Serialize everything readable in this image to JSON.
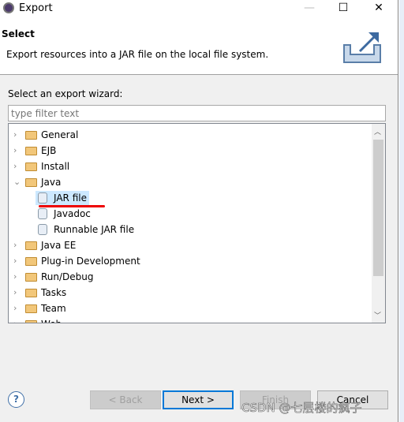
{
  "window": {
    "title": "Export",
    "minimize": "—",
    "maximize": "☐",
    "close": "✕"
  },
  "header": {
    "title": "Select",
    "description": "Export resources into a JAR file on the local file system."
  },
  "wizard_label": "Select an export wizard:",
  "filter": {
    "placeholder": "type filter text",
    "value": ""
  },
  "tree": [
    {
      "label": "General",
      "expanded": false
    },
    {
      "label": "EJB",
      "expanded": false
    },
    {
      "label": "Install",
      "expanded": false
    },
    {
      "label": "Java",
      "expanded": true
    },
    {
      "label": "JAR file",
      "child": true,
      "selected": true
    },
    {
      "label": "Javadoc",
      "child": true
    },
    {
      "label": "Runnable JAR file",
      "child": true
    },
    {
      "label": "Java EE",
      "expanded": false
    },
    {
      "label": "Plug-in Development",
      "expanded": false
    },
    {
      "label": "Run/Debug",
      "expanded": false
    },
    {
      "label": "Tasks",
      "expanded": false
    },
    {
      "label": "Team",
      "expanded": false
    },
    {
      "label": "Web",
      "expanded": false
    }
  ],
  "buttons": {
    "help": "?",
    "back": "< Back",
    "next": "Next >",
    "finish": "Finish",
    "cancel": "Cancel"
  },
  "watermark": "CSDN @七层楼的疯子",
  "colors": {
    "selection": "#cce8ff",
    "focus": "#0078d7",
    "annotation": "#e00000"
  }
}
